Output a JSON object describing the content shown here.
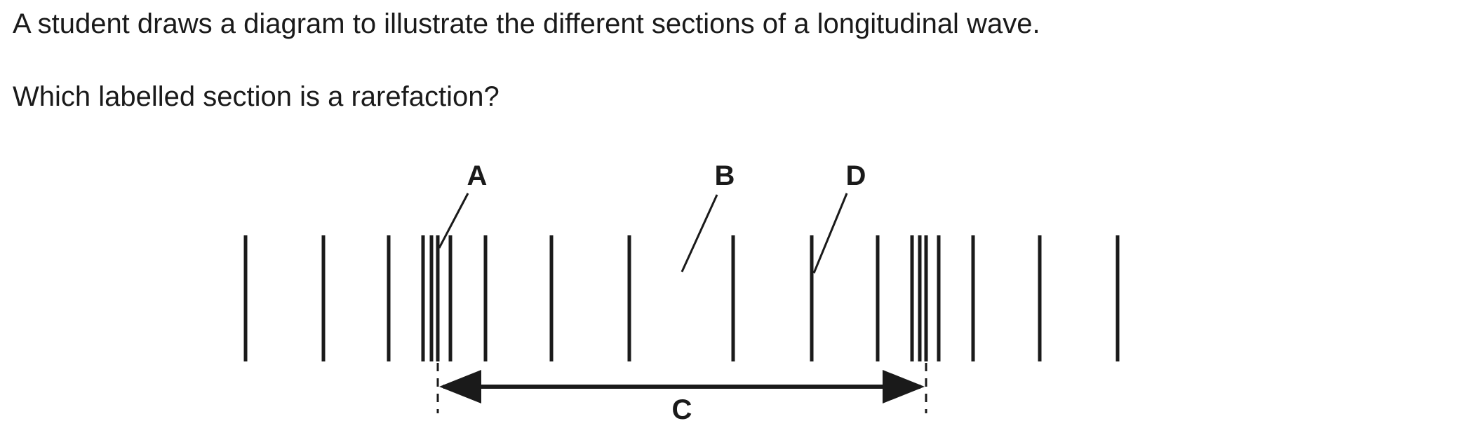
{
  "question": {
    "intro": "A student draws a diagram to illustrate the different sections of a longitudinal wave.",
    "prompt": "Which labelled section is a rarefaction?"
  },
  "diagram": {
    "labels": {
      "a": "A",
      "b": "B",
      "c": "C",
      "d": "D"
    },
    "colors": {
      "ink": "#1a1a1a"
    }
  }
}
